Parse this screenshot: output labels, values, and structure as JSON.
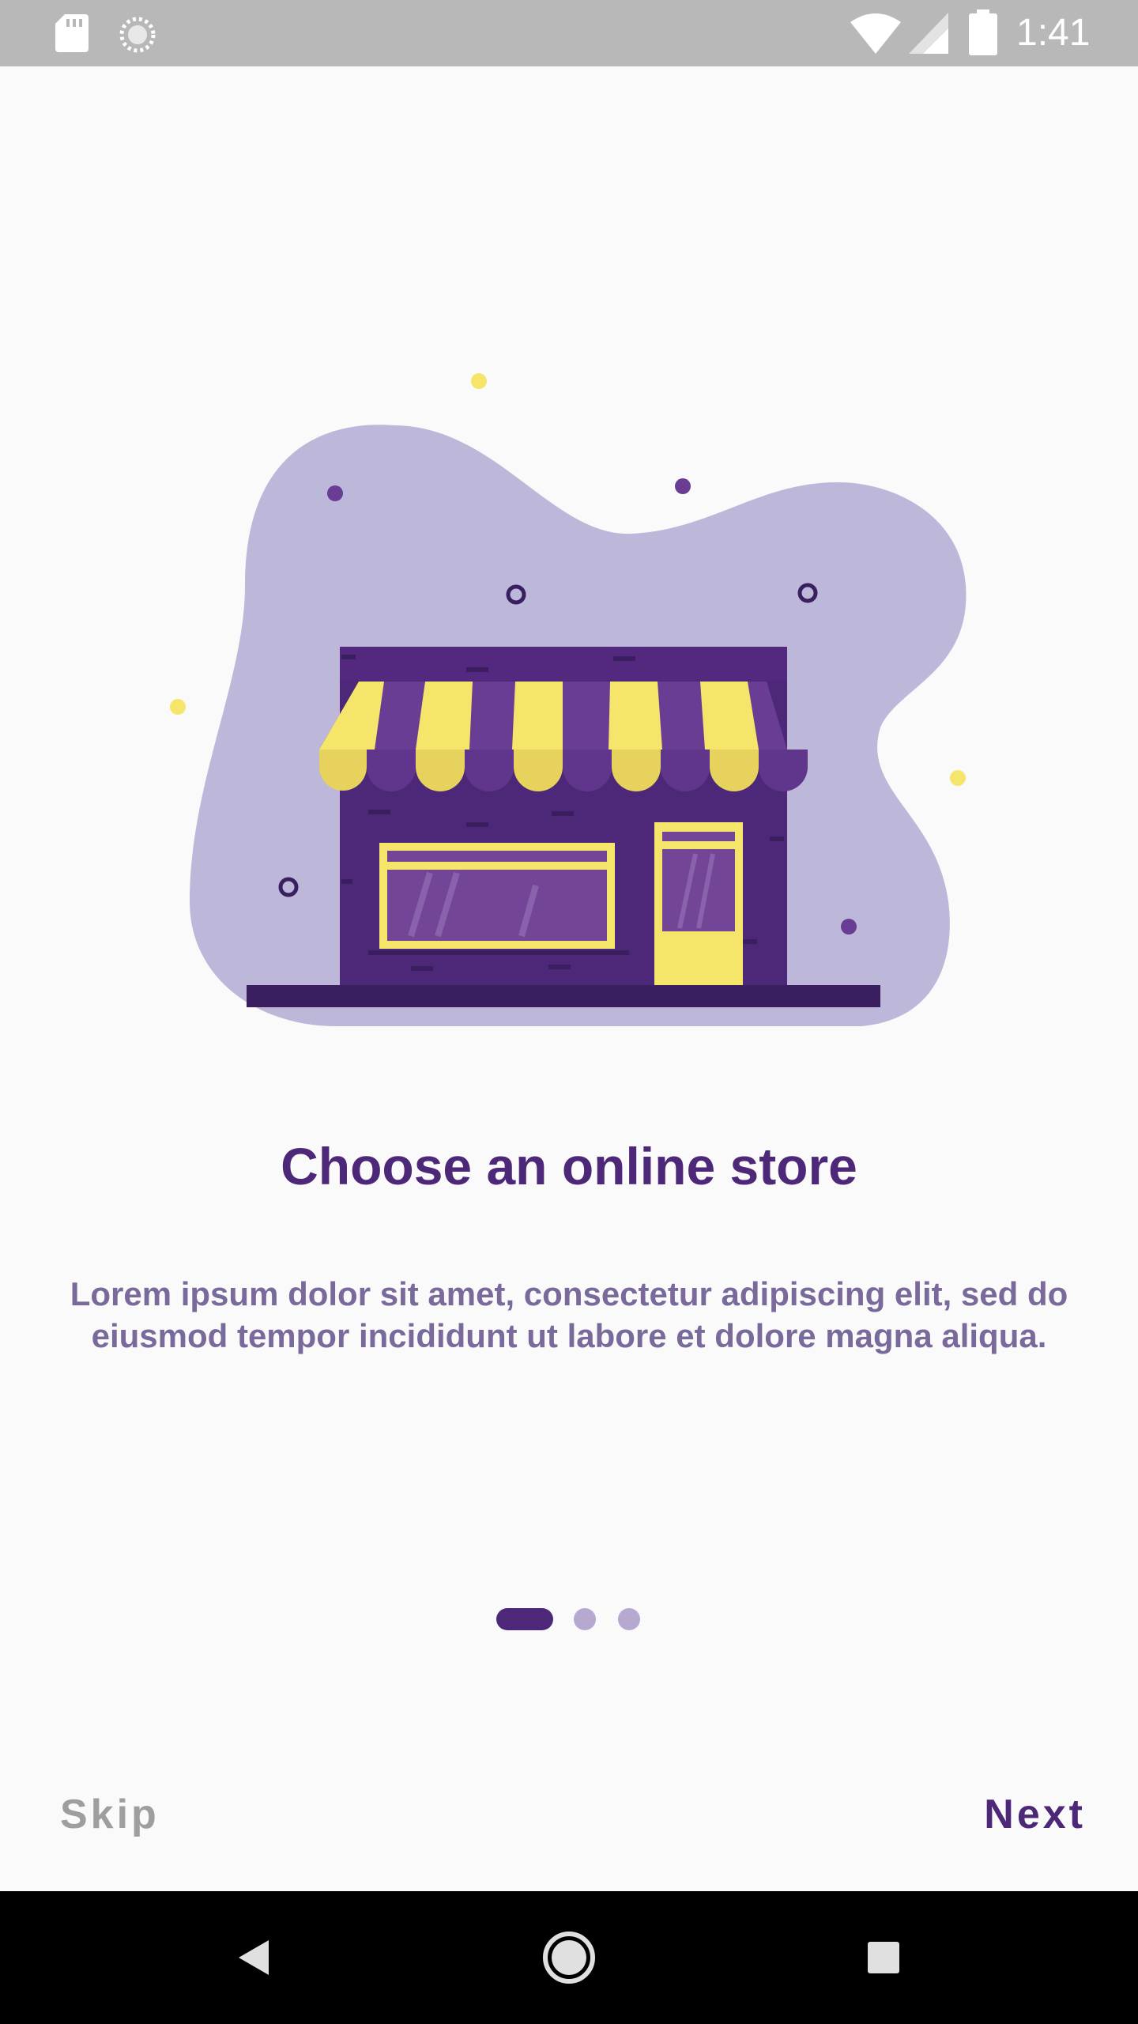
{
  "status_bar": {
    "time": "1:41",
    "icons": [
      "sd-card-icon",
      "sync-icon",
      "wifi-icon",
      "cell-signal-icon",
      "battery-icon"
    ]
  },
  "illustration": {
    "name": "storefront-illustration",
    "colors": {
      "blob": "#bdb7d9",
      "building": "#4d2878",
      "awning_yellow": "#f6e56b",
      "awning_purple": "#6a3d95",
      "ground": "#3a1f60"
    }
  },
  "onboarding": {
    "title": "Choose an online store",
    "description": "Lorem ipsum dolor sit amet, consectetur adipiscing elit, sed do eiusmod tempor incididunt ut labore et dolore magna aliqua.",
    "page_count": 3,
    "current_page": 1
  },
  "footer": {
    "skip_label": "Skip",
    "next_label": "Next"
  },
  "nav_bar": {
    "icons": [
      "back-icon",
      "home-icon",
      "recents-icon"
    ]
  },
  "colors": {
    "primary": "#4d2878",
    "text_secondary": "#7a6a9c",
    "indicator_inactive": "#b6a9d0",
    "skip_gray": "#9e9e9e",
    "background": "#fafafa"
  }
}
